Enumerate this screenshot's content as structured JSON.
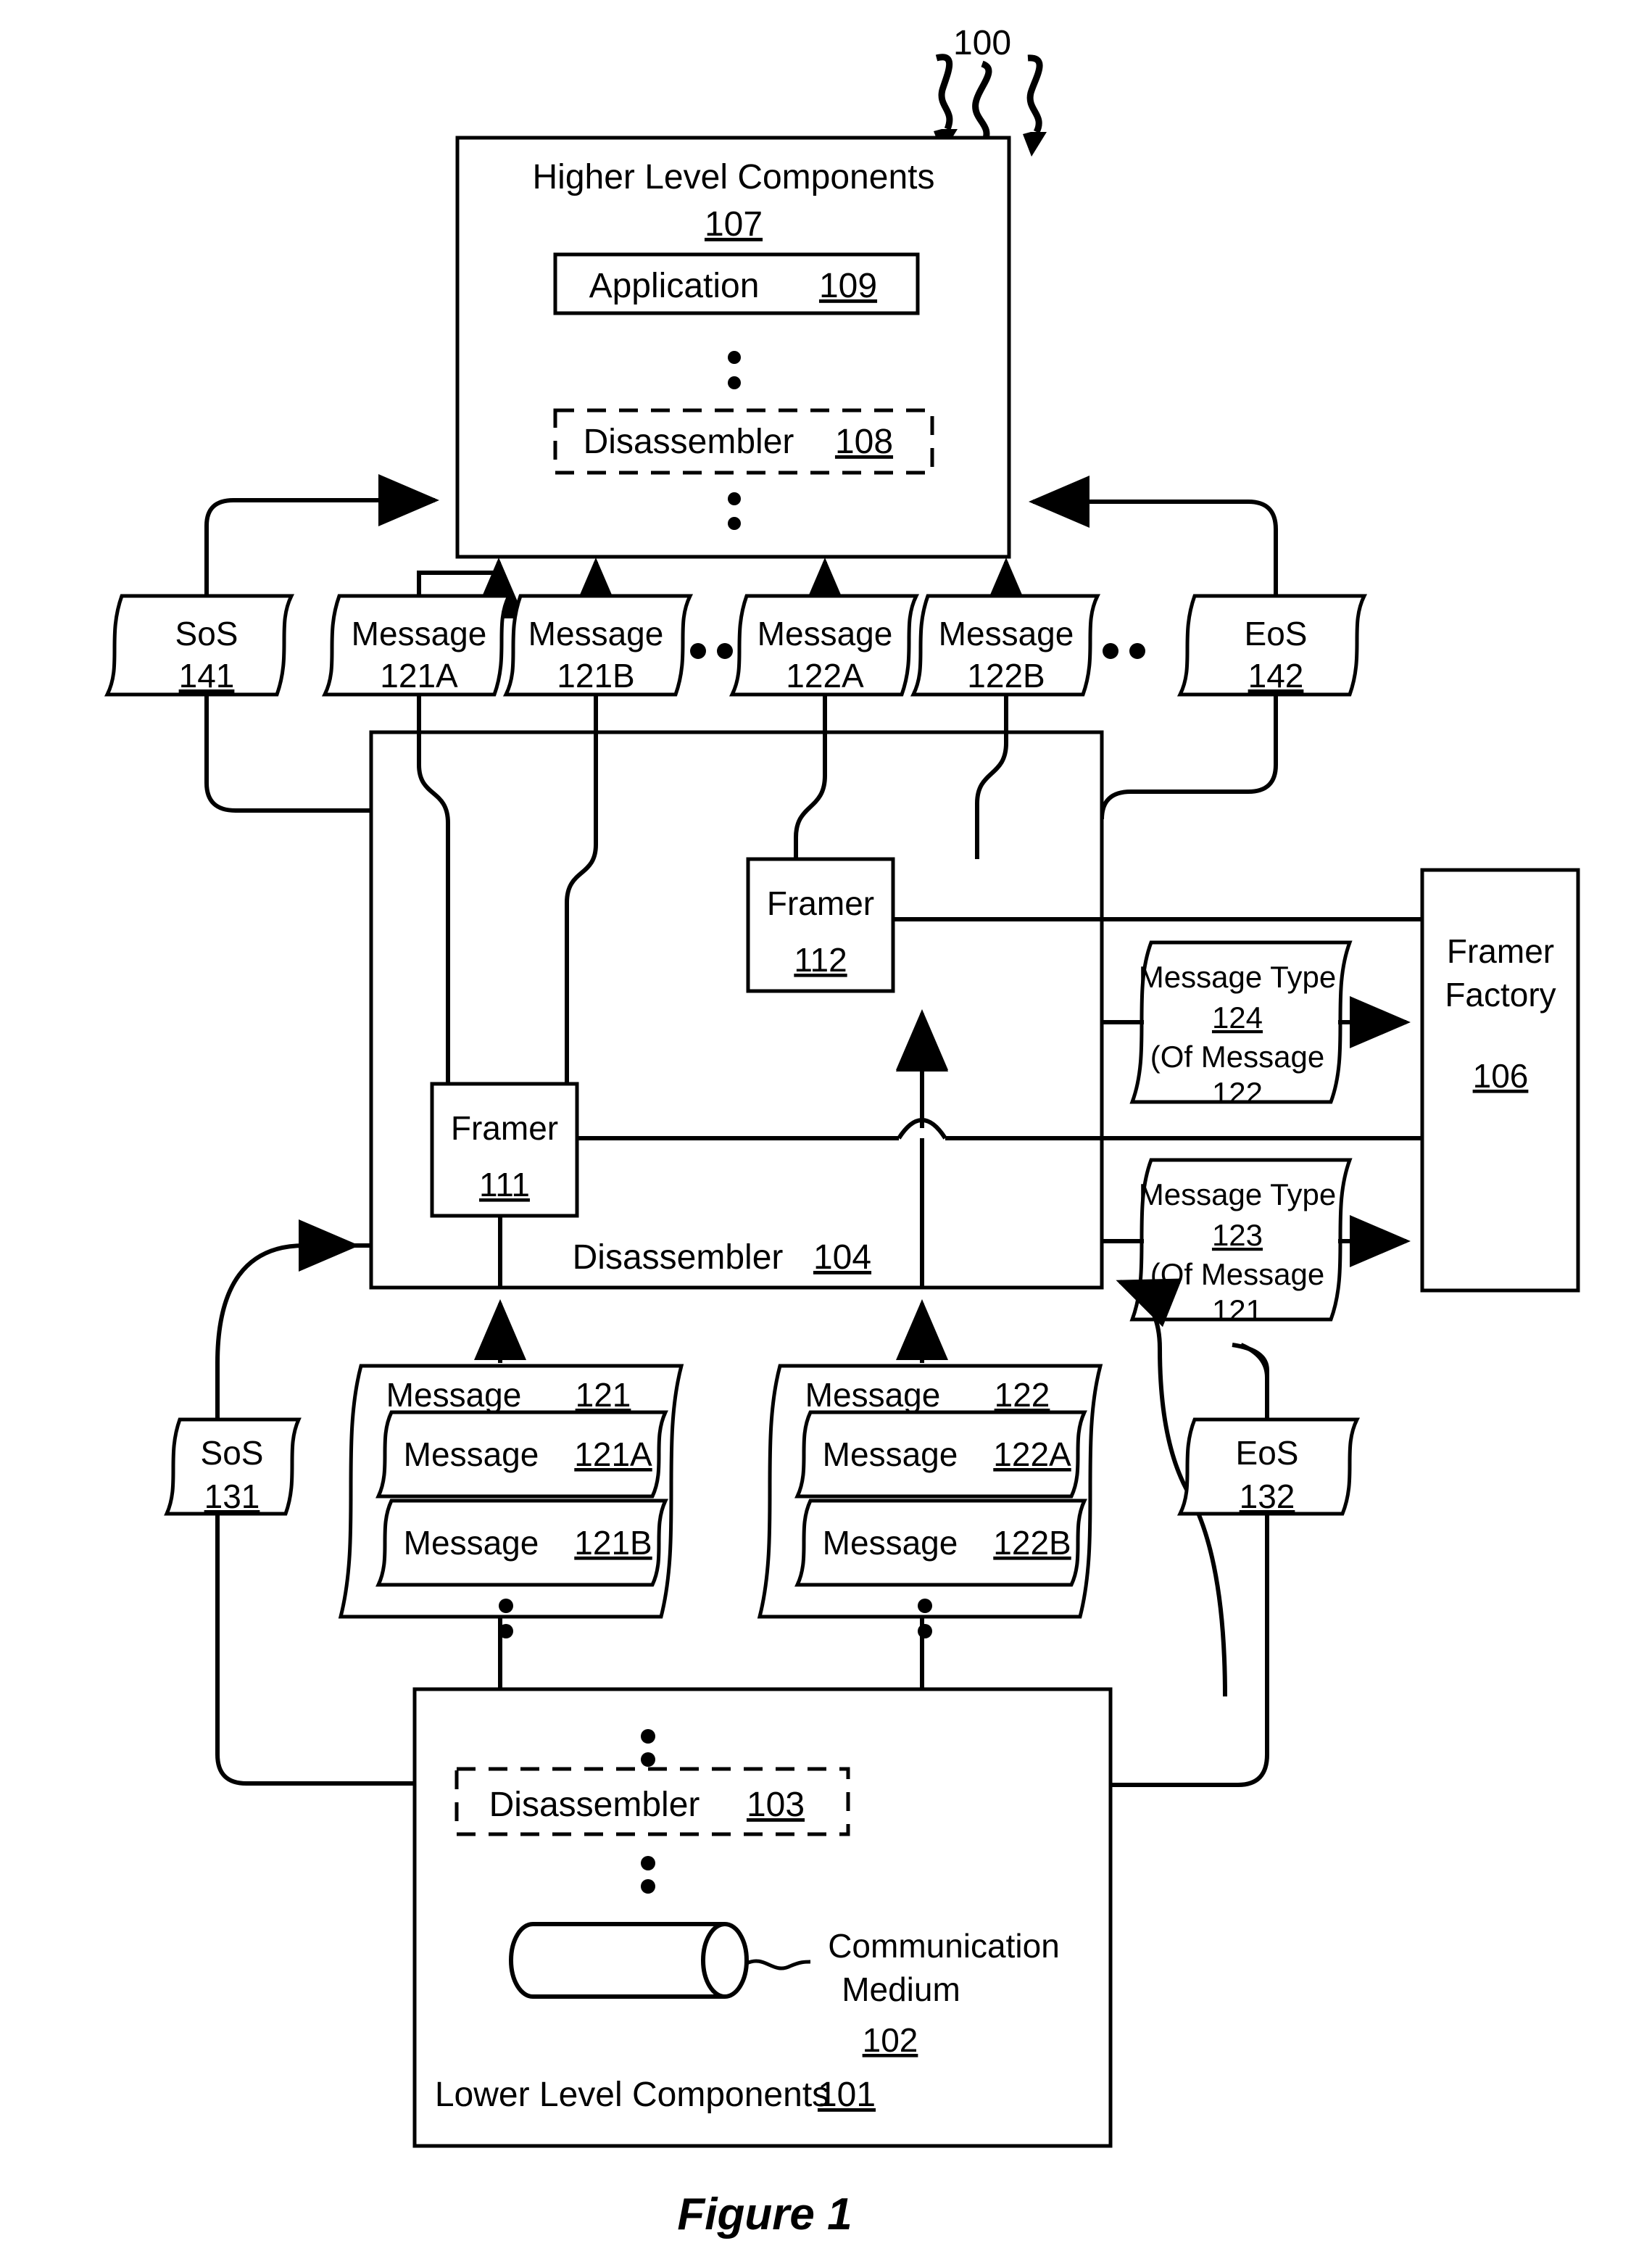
{
  "figure": {
    "caption": "Figure 1",
    "system_label": "100"
  },
  "higher_level": {
    "title": "Higher Level Components",
    "ref": "107",
    "application": {
      "label": "Application",
      "ref": "109"
    },
    "disassembler": {
      "label": "Disassembler",
      "ref": "108"
    }
  },
  "top_row": [
    {
      "name": "SoS",
      "ref": "141",
      "ref_underlined": true
    },
    {
      "name": "Message",
      "ref": "121A",
      "ref_underlined": false
    },
    {
      "name": "Message",
      "ref": "121B",
      "ref_underlined": false
    },
    {
      "name": "Message",
      "ref": "122A",
      "ref_underlined": false
    },
    {
      "name": "Message",
      "ref": "122B",
      "ref_underlined": false
    },
    {
      "name": "EoS",
      "ref": "142",
      "ref_underlined": true
    }
  ],
  "disassembler_104": {
    "label": "Disassembler",
    "ref": "104",
    "framers": [
      {
        "label": "Framer",
        "ref": "111"
      },
      {
        "label": "Framer",
        "ref": "112"
      }
    ]
  },
  "framer_factory": {
    "line1": "Framer",
    "line2": "Factory",
    "ref": "106"
  },
  "message_types": [
    {
      "line1": "Message Type",
      "ref": "124",
      "line3": "(Of Message",
      "line4": "122"
    },
    {
      "line1": "Message Type",
      "ref": "123",
      "line3": "(Of Message",
      "line4": "121"
    }
  ],
  "bottom_row": {
    "sos": {
      "name": "SoS",
      "ref": "131"
    },
    "eos": {
      "name": "EoS",
      "ref": "132"
    },
    "groups": [
      {
        "label": "Message",
        "ref": "121",
        "children": [
          {
            "label": "Message",
            "ref": "121A"
          },
          {
            "label": "Message",
            "ref": "121B"
          }
        ]
      },
      {
        "label": "Message",
        "ref": "122",
        "children": [
          {
            "label": "Message",
            "ref": "122A"
          },
          {
            "label": "Message",
            "ref": "122B"
          }
        ]
      }
    ]
  },
  "lower_level": {
    "title": "Lower Level Components",
    "ref": "101",
    "disassembler": {
      "label": "Disassembler",
      "ref": "103"
    },
    "medium": {
      "line1": "Communication",
      "line2": "Medium",
      "ref": "102"
    }
  },
  "colors": {
    "ink": "#000000",
    "paper": "#ffffff"
  }
}
